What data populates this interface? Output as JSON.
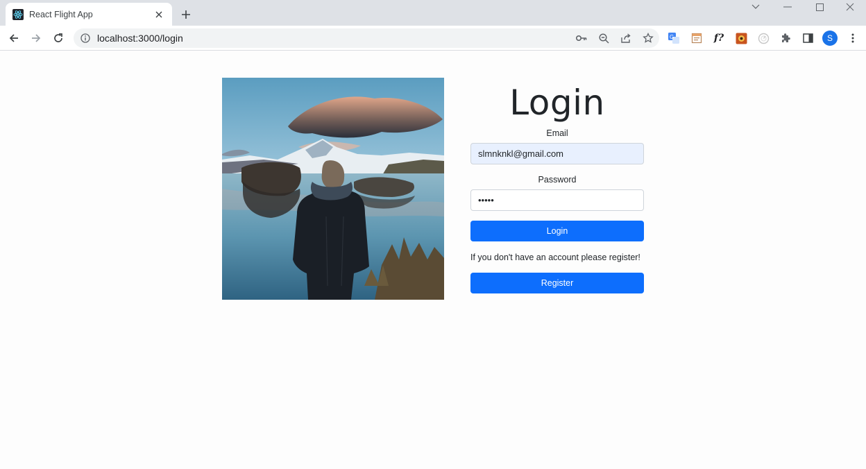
{
  "browser": {
    "tab_title": "React Flight App",
    "url": "localhost:3000/login",
    "profile_initial": "S",
    "extension_formula_label": "f?"
  },
  "page": {
    "heading": "Login",
    "email_label": "Email",
    "email_value": "slmnknkl@gmail.com",
    "password_label": "Password",
    "password_value": "•••••",
    "login_button": "Login",
    "register_note": "If you don't have an account please register!",
    "register_button": "Register"
  },
  "colors": {
    "primary": "#0d6efd",
    "autofill_bg": "#e8f0fe"
  }
}
